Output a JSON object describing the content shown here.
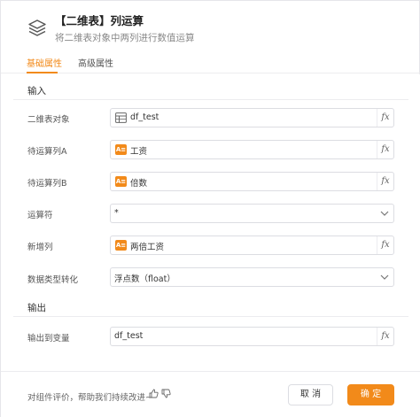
{
  "header": {
    "title": "【二维表】列运算",
    "subtitle": "将二维表对象中两列进行数值运算",
    "icon": "layers-icon"
  },
  "tabs": [
    {
      "label": "基础属性",
      "active": true
    },
    {
      "label": "高级属性",
      "active": false
    }
  ],
  "sections": {
    "input_title": "输入",
    "output_title": "输出"
  },
  "fields": {
    "table_obj": {
      "label": "二维表对象",
      "value": "df_test",
      "icon": "table-icon"
    },
    "col_a": {
      "label": "待运算列A",
      "value": "工资",
      "icon": "ab-text-icon"
    },
    "col_b": {
      "label": "待运算列B",
      "value": "倍数",
      "icon": "ab-text-icon"
    },
    "operator": {
      "label": "运算符",
      "value": "*"
    },
    "new_col": {
      "label": "新增列",
      "value": "两倍工资",
      "icon": "ab-text-icon"
    },
    "dtype": {
      "label": "数据类型转化",
      "value": "浮点数（float）"
    },
    "output_var": {
      "label": "输出到变量",
      "value": "df_test"
    }
  },
  "fx_label": "fx",
  "ab_glyph": "A≡",
  "footer": {
    "feedback": "对组件评价，帮助我们持续改进~",
    "cancel": "取 消",
    "ok": "确 定"
  },
  "colors": {
    "accent": "#f28a1a",
    "border": "#dcdde2"
  }
}
